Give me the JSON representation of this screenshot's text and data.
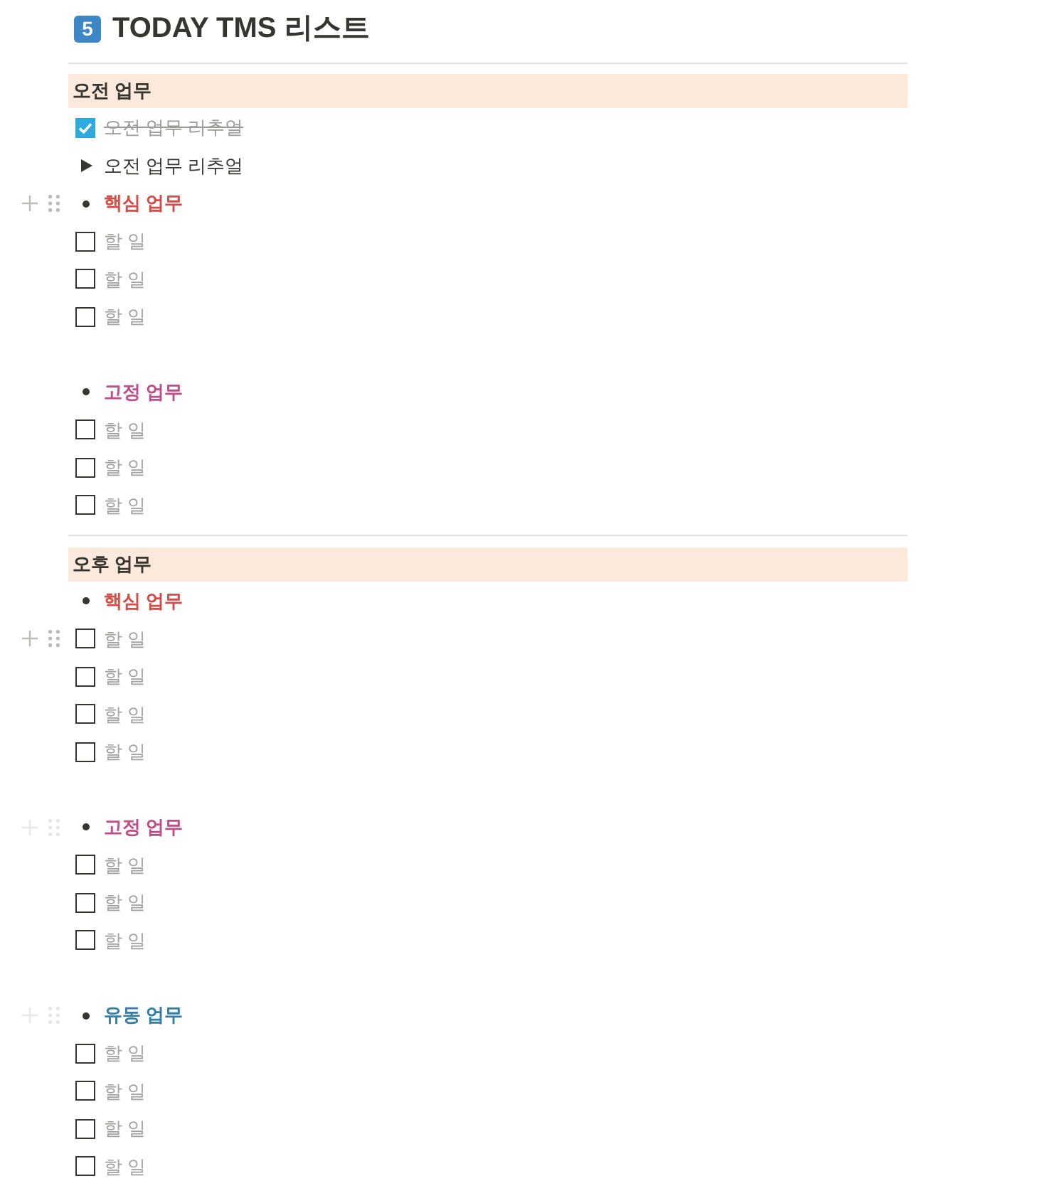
{
  "page": {
    "icon": "5",
    "title": "TODAY TMS 리스트"
  },
  "blocks": [
    {
      "kind": "divider",
      "handles": false
    },
    {
      "kind": "heading",
      "text": "오전 업무",
      "handles": false
    },
    {
      "kind": "todo",
      "text": "오전 업무 리추얼",
      "checked": true,
      "handles": false
    },
    {
      "kind": "toggle",
      "text": "오전 업무 리추얼",
      "expanded": false,
      "handles": false
    },
    {
      "kind": "bullet",
      "text": "핵심 업무",
      "color": "#d44c47",
      "handles": true,
      "handles_faded": false
    },
    {
      "kind": "todo",
      "placeholder": "할 일",
      "checked": false,
      "handles": false
    },
    {
      "kind": "todo",
      "placeholder": "할 일",
      "checked": false,
      "handles": false
    },
    {
      "kind": "todo",
      "placeholder": "할 일",
      "checked": false,
      "handles": false
    },
    {
      "kind": "empty",
      "handles": false
    },
    {
      "kind": "bullet",
      "text": "고정 업무",
      "color": "#c14c8a",
      "handles": false
    },
    {
      "kind": "todo",
      "placeholder": "할 일",
      "checked": false,
      "handles": false
    },
    {
      "kind": "todo",
      "placeholder": "할 일",
      "checked": false,
      "handles": false
    },
    {
      "kind": "todo",
      "placeholder": "할 일",
      "checked": false,
      "handles": false
    },
    {
      "kind": "divider",
      "handles": false
    },
    {
      "kind": "heading",
      "text": "오후 업무",
      "handles": false
    },
    {
      "kind": "bullet",
      "text": "핵심 업무",
      "color": "#d44c47",
      "handles": false
    },
    {
      "kind": "todo",
      "placeholder": "할 일",
      "checked": false,
      "handles": true,
      "handles_faded": false
    },
    {
      "kind": "todo",
      "placeholder": "할 일",
      "checked": false,
      "handles": false
    },
    {
      "kind": "todo",
      "placeholder": "할 일",
      "checked": false,
      "handles": false
    },
    {
      "kind": "todo",
      "placeholder": "할 일",
      "checked": false,
      "handles": false
    },
    {
      "kind": "empty",
      "handles": false
    },
    {
      "kind": "bullet",
      "text": "고정 업무",
      "color": "#c14c8a",
      "handles": true,
      "handles_faded": true
    },
    {
      "kind": "todo",
      "placeholder": "할 일",
      "checked": false,
      "handles": false
    },
    {
      "kind": "todo",
      "placeholder": "할 일",
      "checked": false,
      "handles": false
    },
    {
      "kind": "todo",
      "placeholder": "할 일",
      "checked": false,
      "handles": false
    },
    {
      "kind": "empty",
      "handles": false
    },
    {
      "kind": "bullet",
      "text": "유동 업무",
      "color": "#337ea9",
      "handles": true,
      "handles_faded": true
    },
    {
      "kind": "todo",
      "placeholder": "할 일",
      "checked": false,
      "handles": false
    },
    {
      "kind": "todo",
      "placeholder": "할 일",
      "checked": false,
      "handles": false
    },
    {
      "kind": "todo",
      "placeholder": "할 일",
      "checked": false,
      "handles": false
    },
    {
      "kind": "todo",
      "placeholder": "할 일",
      "checked": false,
      "handles": false
    }
  ]
}
